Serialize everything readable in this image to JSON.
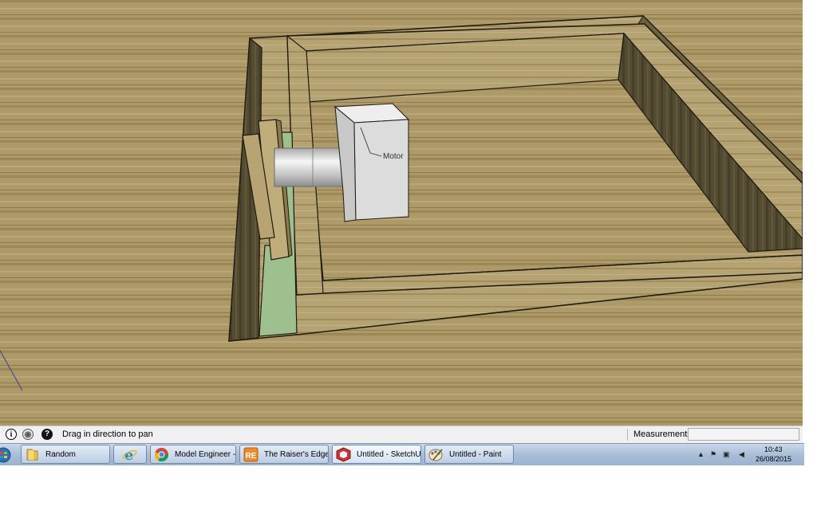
{
  "scene": {
    "annotation_label": "Motor"
  },
  "status_bar": {
    "status_text": "Drag in direction to pan",
    "measurements_label": "Measurements",
    "measurements_value": ""
  },
  "taskbar": {
    "items": [
      {
        "label": "Random",
        "icon": "folder-icon"
      },
      {
        "label": "",
        "icon": "internet-explorer-icon"
      },
      {
        "label": "Model Engineer - ...",
        "icon": "chrome-icon"
      },
      {
        "label": "The Raiser's Edge ...",
        "icon": "raisers-edge-icon"
      },
      {
        "label": "Untitled - SketchUp",
        "icon": "sketchup-icon"
      },
      {
        "label": "Untitled - Paint",
        "icon": "paint-icon"
      }
    ],
    "clock_time": "10:43",
    "clock_date": "26/08/2015"
  },
  "colors": {
    "wood_light": "#b5a06c",
    "wood_dark": "#514a30",
    "green_panel": "#9ec08e",
    "motor_body": "#dcdcdc",
    "taskbar": "#b2c4dc"
  }
}
